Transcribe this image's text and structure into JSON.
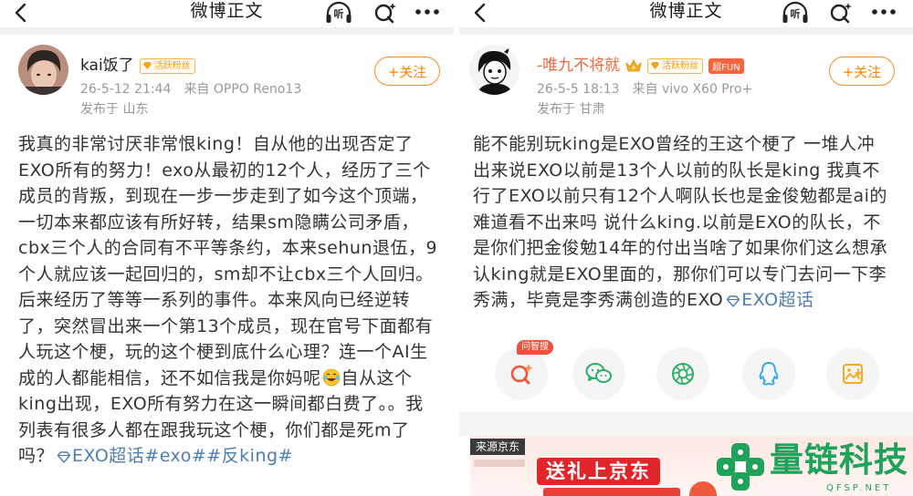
{
  "panels": [
    {
      "topbar": {
        "title": "微博正文",
        "listen_label": "听"
      },
      "user": {
        "name": "kai饭了",
        "badge": "活跃粉丝",
        "time": "26-5-12 21:44",
        "source": "来自 OPPO Reno13",
        "location": "发布于 山东"
      },
      "follow_label": "+关注",
      "post": {
        "lines": [
          "我真的非常讨厌非常恨king！自从他的出现否定了",
          "EXO所有的努力！exo从最初的12个人，经历了三个",
          "成员的背叛，到现在一步一步走到了如今这个顶端，",
          "一切本来都应该有所好转，结果sm隐瞒公司矛盾，",
          "cbx三个人的合同有不平等条约，本来sehun退伍，9",
          "个人就应该一起回归的，sm却不让cbx三个人回归。",
          "后来经历了等等一系列的事件。本来风向已经逆转",
          "了，突然冒出来一个第13个成员，现在官号下面都有",
          "人玩这个梗，玩的这个梗到底什么心理？连一个AI生",
          "成的人都能相信，还不如信我是你妈呢",
          "king出现，EXO所有努力在这一瞬间都白费了。。我",
          "列表有很多人都在跟我玩这个梗，你们都是死m了"
        ],
        "emoji": "laughing-tears-icon",
        "emoji_after": "自从这个",
        "tail": "吗？",
        "topic": "EXO超话#exo##反king#"
      }
    },
    {
      "topbar": {
        "title": "微博正文",
        "listen_label": "听"
      },
      "user": {
        "name": "-唯九不将就",
        "badge": "活跃粉丝",
        "fun_badge": "超FUN",
        "time": "26-5-5 18:13",
        "source": "来自 vivo X60 Pro+",
        "location": "发布于 甘肃"
      },
      "follow_label": "+关注",
      "post": {
        "lines": [
          "能不能别玩king是EXO曾经的王这个梗了 一堆人冲",
          "出来说EXO以前是13个人以前的队长是king 我真不",
          "行了EXO以前只有12个人啊队长也是金俊勉都是ai的",
          "难道看不出来吗 说什么king.以前是EXO的队长，不",
          "是你们把金俊勉14年的付出当啥了如果你们这么想承",
          "认king就是EXO里面的，那你们可以专门去问一下李"
        ],
        "tail": "秀满，毕竟是李秀满创造的EXO",
        "topic": "EXO超话"
      },
      "share": {
        "badge": "问智搜",
        "icons": [
          "wenzhisou-icon",
          "wechat-icon",
          "moments-icon",
          "qq-icon",
          "save-image-icon"
        ]
      },
      "ad": {
        "source_label": "来源京东",
        "headline": "送礼上京东"
      }
    }
  ],
  "watermark": {
    "brand": "量链科技",
    "domain": "QFSP.NET"
  },
  "colors": {
    "accent": "#ff8200",
    "topic_link": "#507daf",
    "vip_name": "#eb6a3c",
    "watermark": "#1fa35a",
    "ad_red": "#e0262b"
  }
}
